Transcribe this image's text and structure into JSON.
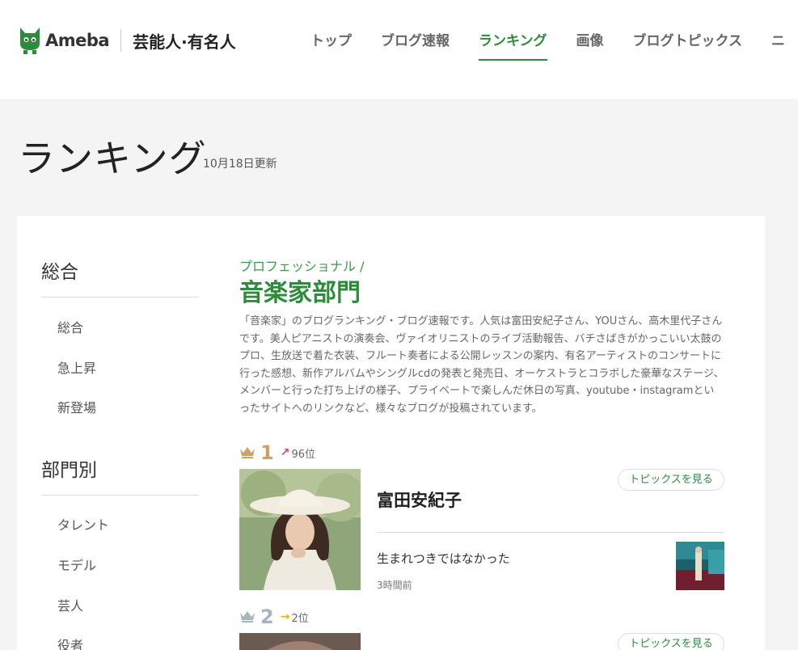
{
  "header": {
    "logo_text": "Ameba",
    "logo_sub": "芸能人·有名人",
    "nav": [
      "トップ",
      "ブログ速報",
      "ランキング",
      "画像",
      "ブログトピックス",
      "ニ"
    ]
  },
  "page": {
    "title": "ランキング",
    "updated": "10月18日更新"
  },
  "sidebar": {
    "section1_heading": "総合",
    "section1_items": [
      "総合",
      "急上昇",
      "新登場"
    ],
    "section2_heading": "部門別",
    "section2_items": [
      "タレント",
      "モデル",
      "芸人",
      "役者"
    ]
  },
  "category": {
    "parent": "プロフェッショナル /",
    "title": "音楽家部門",
    "description": "「音楽家」のブログランキング・ブログ速報です。人気は富田安紀子さん、YOUさん、高木里代子さんです。美人ピアニストの演奏会、ヴァイオリニストのライブ活動報告、バチさばきがかっこいい太鼓のプロ、生放送で着た衣装、フルート奏者による公開レッスンの案内、有名アーティストのコンサートに行った感想、新作アルバムやシングルcdの発表と発売日、オーケストラとコラボした豪華なステージ、メンバーと行った打ち上げの様子、プライベートで楽しんだ休日の写真、youtube・instagramといったサイトへのリンクなど、様々なブログが投稿されています。"
  },
  "rankings": [
    {
      "rank": "1",
      "arrow": "↗",
      "prev": "96位",
      "name": "富田安紀子",
      "topics_label": "トピックスを見る",
      "entry_title": "生まれつきではなかった",
      "entry_time": "3時間前",
      "crown_color": "#c9a36a",
      "arrow_color": "#e0436a"
    },
    {
      "rank": "2",
      "arrow": "→",
      "prev": "2位",
      "name": "",
      "topics_label": "トピックスを見る",
      "entry_title": "",
      "entry_time": "",
      "crown_color": "#a9b3bd",
      "arrow_color": "#e8b400"
    }
  ],
  "colors": {
    "accent": "#2d8c3c"
  }
}
